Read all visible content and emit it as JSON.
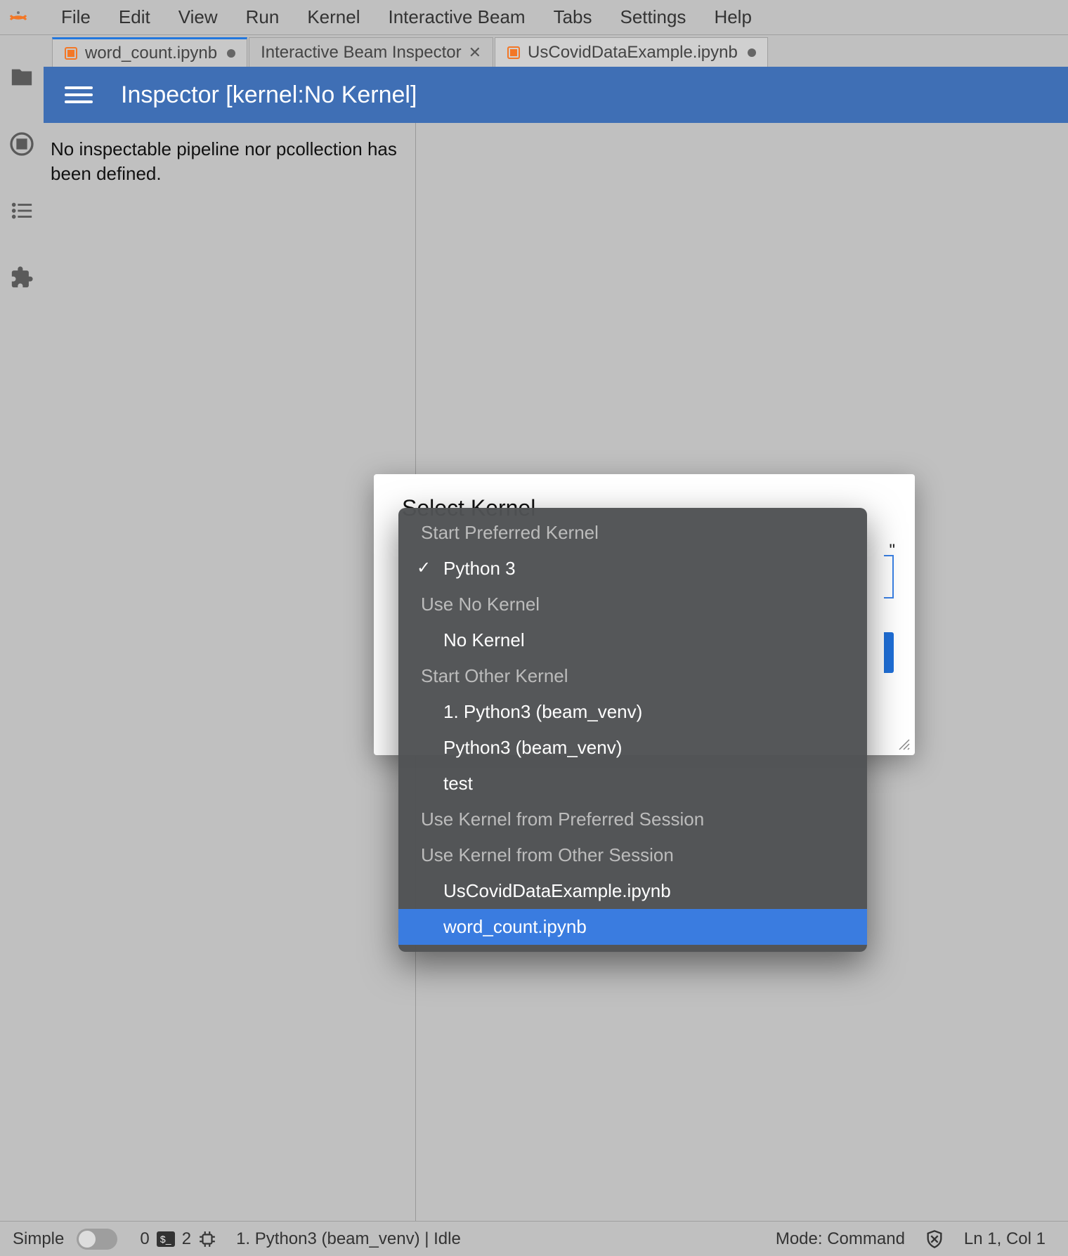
{
  "menubar": {
    "items": [
      "File",
      "Edit",
      "View",
      "Run",
      "Kernel",
      "Interactive Beam",
      "Tabs",
      "Settings",
      "Help"
    ]
  },
  "sidebar": {
    "icons": [
      "folder-icon",
      "stop-circle-icon",
      "list-icon",
      "extension-icon"
    ]
  },
  "tabs": [
    {
      "label": "word_count.ipynb",
      "dirty": true,
      "hasIcon": true,
      "closable": false
    },
    {
      "label": "Interactive Beam Inspector",
      "dirty": false,
      "hasIcon": false,
      "closable": true,
      "active": true
    },
    {
      "label": "UsCovidDataExample.ipynb",
      "dirty": true,
      "hasIcon": true,
      "closable": false,
      "truncated": true
    }
  ],
  "inspector": {
    "title": "Inspector [kernel:No Kernel]",
    "empty_message": "No inspectable pipeline nor pcollection has been defined."
  },
  "dialog": {
    "title": "Select Kernel",
    "hint_suffix": "\"",
    "sections": [
      {
        "header": "Start Preferred Kernel",
        "items": [
          {
            "label": "Python 3",
            "checked": true
          }
        ]
      },
      {
        "header": "Use No Kernel",
        "items": [
          {
            "label": "No Kernel"
          }
        ]
      },
      {
        "header": "Start Other Kernel",
        "items": [
          {
            "label": "1. Python3 (beam_venv)"
          },
          {
            "label": "Python3 (beam_venv)"
          },
          {
            "label": "test"
          }
        ]
      },
      {
        "header": "Use Kernel from Preferred Session",
        "items": []
      },
      {
        "header": "Use Kernel from Other Session",
        "items": [
          {
            "label": "UsCovidDataExample.ipynb"
          },
          {
            "label": "word_count.ipynb",
            "highlight": true
          }
        ]
      }
    ]
  },
  "statusbar": {
    "left_label": "Simple",
    "counts": {
      "a": "0",
      "b": "2"
    },
    "kernel": "1. Python3 (beam_venv) | Idle",
    "mode": "Mode: Command",
    "position": "Ln 1, Col 1"
  }
}
